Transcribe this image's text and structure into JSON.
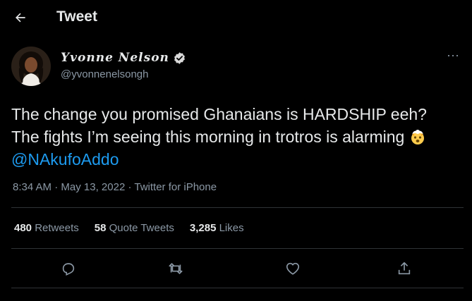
{
  "header": {
    "title": "Tweet",
    "back_icon": "arrow-left-icon"
  },
  "author": {
    "display_name": "Yvonne Nelson",
    "handle": "@yvonnenelsongh",
    "verified_icon": "verified-badge-icon"
  },
  "more_icon": "more-dots-icon",
  "more_label": "···",
  "tweet": {
    "text": "The change you promised Ghanaians is HARDSHIP eeh?  The fights I’m seeing this morning in trotros is alarming ",
    "emoji": "exploding-head-emoji",
    "mention": "@NAkufoAddo"
  },
  "meta": {
    "time": "8:34 AM",
    "sep1": " · ",
    "date": "May 13, 2022",
    "sep2": " · ",
    "source": "Twitter for iPhone"
  },
  "stats": {
    "retweets_count": "480",
    "retweets_label": "Retweets",
    "quotes_count": "58",
    "quotes_label": "Quote Tweets",
    "likes_count": "3,285",
    "likes_label": "Likes"
  },
  "actions": [
    "reply-icon",
    "retweet-icon",
    "like-icon",
    "share-icon"
  ],
  "colors": {
    "accent": "#1d9bf0",
    "background": "#000000",
    "muted": "#8b98a5"
  }
}
